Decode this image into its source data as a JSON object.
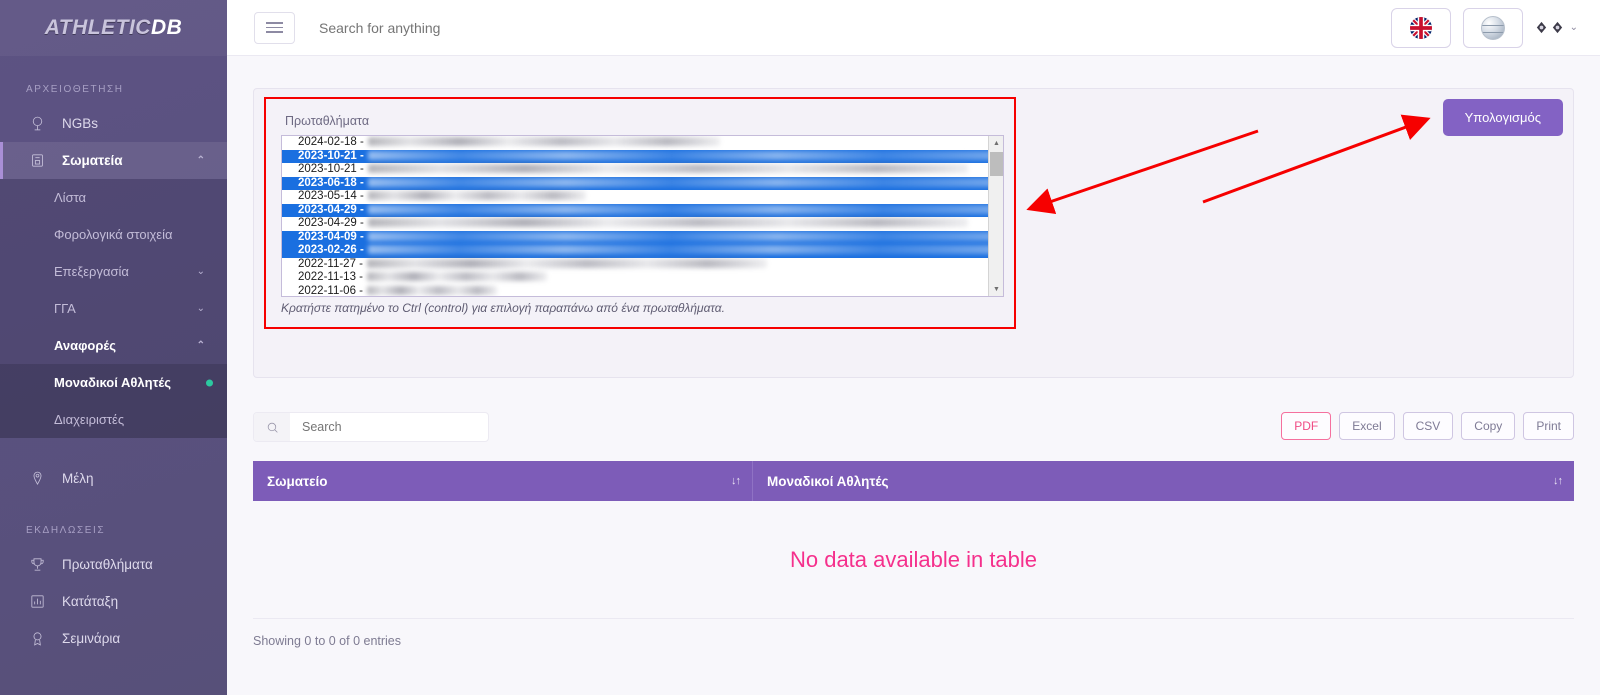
{
  "brand": {
    "part1": "ATHLETIC",
    "part2": "DB"
  },
  "topbar": {
    "search_placeholder": "Search for anything",
    "hamburger_name": "menu-toggle",
    "language_label": "EN",
    "globe_label": "globe"
  },
  "sidebar": {
    "sections": [
      {
        "title": "ΑΡΧΕΙΟΘΕΤΗΣΗ"
      },
      {
        "title": "ΕΚΔΗΛΩΣΕΙΣ"
      }
    ],
    "items": [
      {
        "label": "NGBs",
        "icon": "globe-icon"
      },
      {
        "label": "Σωματεία",
        "icon": "building-icon",
        "chev": "⌃",
        "active": true
      },
      {
        "label": "Λίστα"
      },
      {
        "label": "Φορολογικά στοιχεία"
      },
      {
        "label": "Επεξεργασία",
        "chev": "⌄"
      },
      {
        "label": "ΓΓΑ",
        "chev": "⌄"
      },
      {
        "label": "Αναφορές",
        "chev": "⌃"
      },
      {
        "label": "Μοναδικοί Αθλητές"
      },
      {
        "label": "Διαχειριστές"
      },
      {
        "label": "Μέλη",
        "icon": "person-pin-icon"
      },
      {
        "label": "Πρωταθλήματα",
        "icon": "trophy-icon"
      },
      {
        "label": "Κατάταξη",
        "icon": "bar-chart-icon"
      },
      {
        "label": "Σεμινάρια",
        "icon": "award-icon"
      }
    ]
  },
  "filter": {
    "list_label": "Πρωταθλήματα",
    "help_text": "Κρατήστε πατημένο το Ctrl (control) για επιλογή παραπάνω από ένα πρωταθλήματα.",
    "calc_button": "Υπολογισμός",
    "options": [
      {
        "date": "2024-02-18 -",
        "selected": false,
        "blur_width": 352
      },
      {
        "date": "2023-10-21 -",
        "selected": true,
        "blur_width": 660
      },
      {
        "date": "2023-10-21 -",
        "selected": false,
        "blur_width": 600
      },
      {
        "date": "2023-06-18 -",
        "selected": true,
        "blur_width": 660
      },
      {
        "date": "2023-05-14 -",
        "selected": false,
        "blur_width": 218
      },
      {
        "date": "2023-04-29 -",
        "selected": true,
        "blur_width": 660
      },
      {
        "date": "2023-04-29 -",
        "selected": false,
        "blur_width": 600
      },
      {
        "date": "2023-04-09 -",
        "selected": true,
        "blur_width": 660
      },
      {
        "date": "2023-02-26 -",
        "selected": true,
        "blur_width": 655
      },
      {
        "date": "2022-11-27 -",
        "selected": false,
        "blur_width": 400
      },
      {
        "date": "2022-11-13 -",
        "selected": false,
        "blur_width": 180
      },
      {
        "date": "2022-11-06 -",
        "selected": false,
        "blur_width": 130
      }
    ]
  },
  "table": {
    "search_placeholder": "Search",
    "export_buttons": [
      {
        "label": "PDF",
        "accent": true
      },
      {
        "label": "Excel",
        "accent": false
      },
      {
        "label": "CSV",
        "accent": false
      },
      {
        "label": "Copy",
        "accent": false
      },
      {
        "label": "Print",
        "accent": false
      }
    ],
    "columns": [
      {
        "label": "Σωματείο",
        "sort": "↓↑"
      },
      {
        "label": "Μοναδικοί Αθλητές",
        "sort": "↓↑"
      }
    ],
    "empty_message": "No data available in table",
    "footer": "Showing 0 to 0 of 0 entries"
  },
  "colors": {
    "sidebar": "#5a5180",
    "accent_purple": "#7d5cb8",
    "calc_button": "#8362c4",
    "no_data_pink": "#f5308c",
    "annotation_red": "#f60000",
    "selection_blue": "#1a6fe0"
  }
}
